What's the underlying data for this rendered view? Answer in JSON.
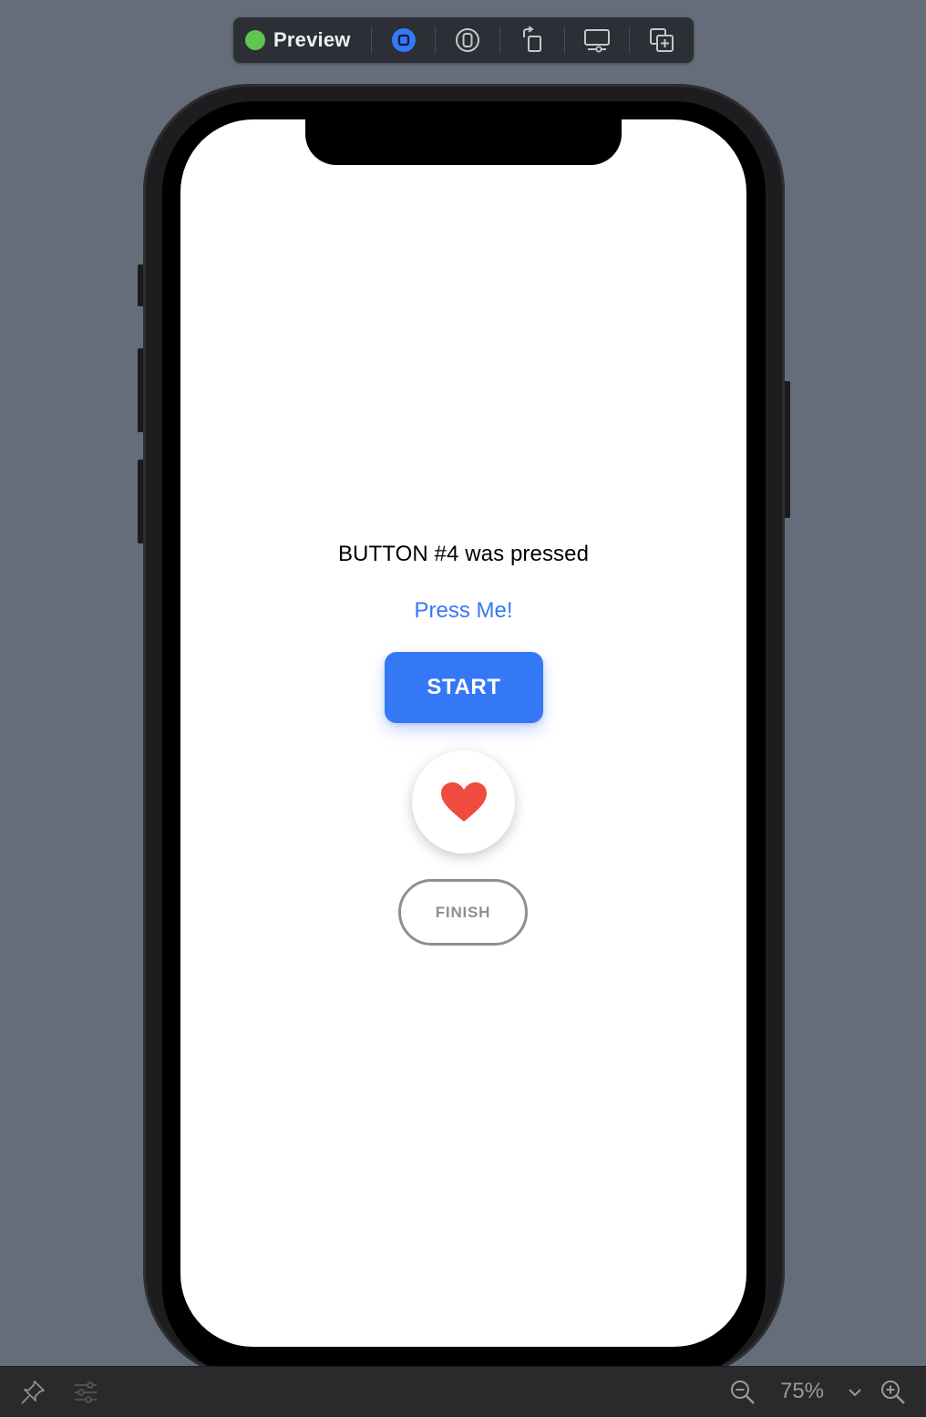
{
  "toolbar": {
    "status_label": "Preview",
    "status_color": "#61c554",
    "buttons": [
      {
        "name": "live-preview-stop",
        "icon": "stop-icon"
      },
      {
        "name": "inspect-preview",
        "icon": "inspect-icon"
      },
      {
        "name": "rotate-device",
        "icon": "rotate-icon"
      },
      {
        "name": "device-settings",
        "icon": "device-settings-icon"
      },
      {
        "name": "duplicate-preview",
        "icon": "duplicate-icon"
      }
    ]
  },
  "screen": {
    "status_message": "BUTTON #4 was pressed",
    "press_me_label": "Press Me!",
    "start_label": "START",
    "heart_icon": "heart-icon",
    "finish_label": "FINISH"
  },
  "bottom_bar": {
    "pin_icon": "pin-icon",
    "adjust_icon": "sliders-icon",
    "zoom_out_icon": "zoom-out-icon",
    "zoom_value": "75%",
    "zoom_dropdown_icon": "chevron-down-icon",
    "zoom_in_icon": "zoom-in-icon"
  },
  "colors": {
    "accent_blue": "#3478f6",
    "heart_red": "#ef4b3f",
    "finish_gray": "#8e8e93",
    "canvas_bg": "#646d79"
  }
}
